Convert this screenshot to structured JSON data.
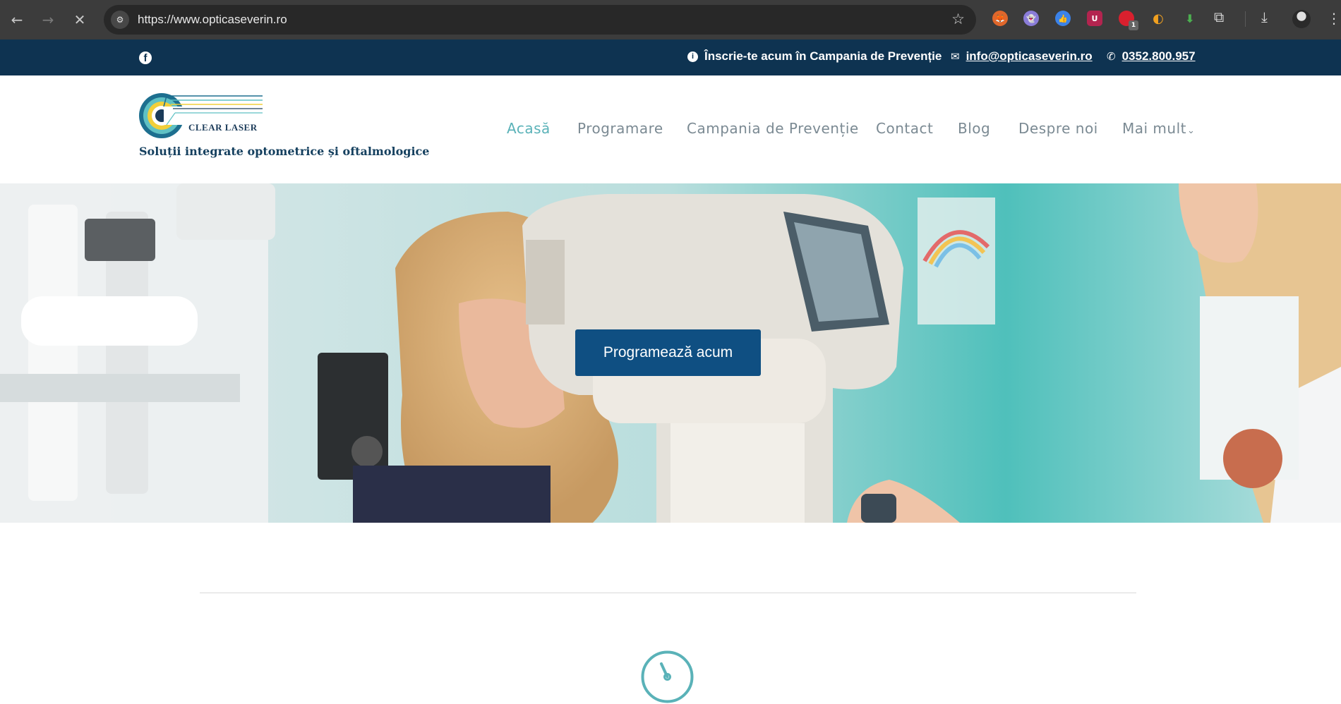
{
  "browser": {
    "url": "https://www.opticaseverin.ro",
    "extension_badge": "1"
  },
  "topbar": {
    "campaign_text": "Înscrie-te acum în Campania de Prevenție",
    "email": "info@opticaseverin.ro",
    "phone": "0352.800.957"
  },
  "header": {
    "logo_text": "CLEAR LASER",
    "tagline": "Soluții integrate optometrice și oftalmologice",
    "nav": {
      "home": "Acasă",
      "booking": "Programare",
      "campaign": "Campania de Prevenție",
      "contact": "Contact",
      "blog": "Blog",
      "about": "Despre noi",
      "more": "Mai mult"
    }
  },
  "hero": {
    "cta_label": "Programează acum"
  },
  "colors": {
    "topbar_bg": "#0e3351",
    "nav_active": "#5ab2b8",
    "nav_default": "#7b8a93",
    "cta_bg": "#0f4f82",
    "accent_teal": "#5ab2b8"
  }
}
